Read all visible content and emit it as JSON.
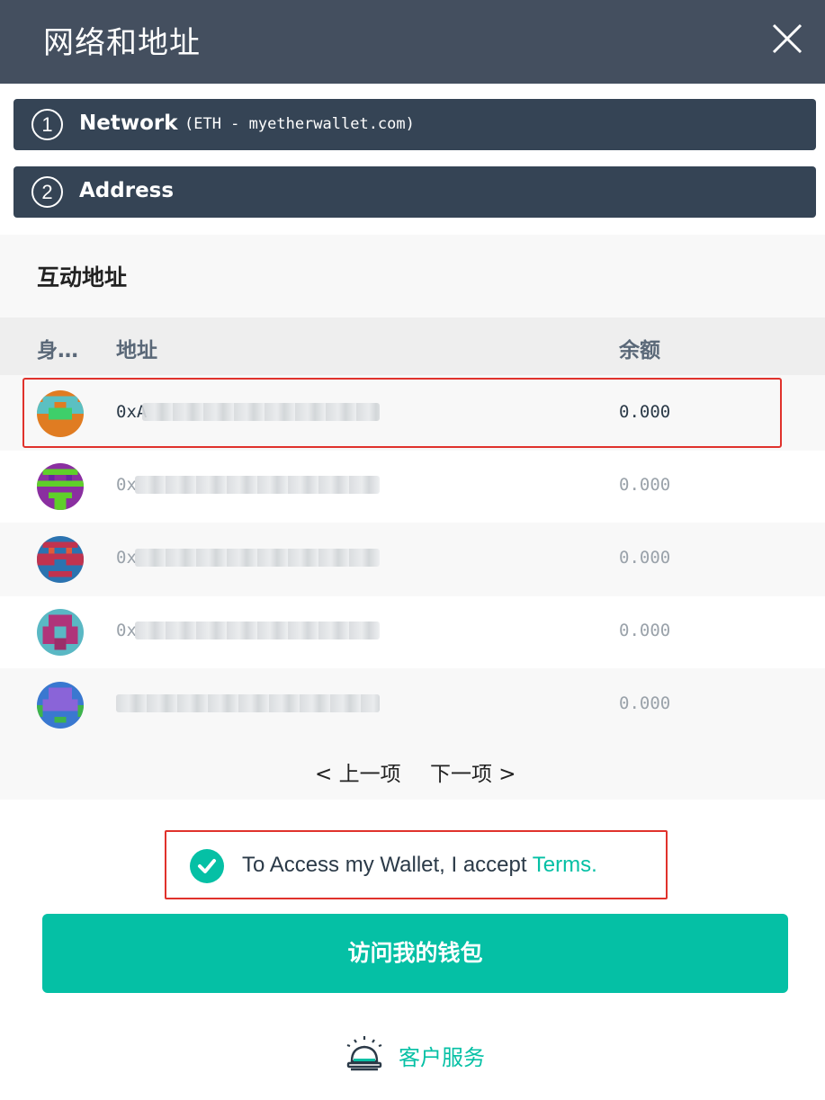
{
  "header": {
    "title": "网络和地址",
    "close_icon": "close-icon"
  },
  "steps": [
    {
      "number": "1",
      "label": "Network",
      "sub": "(ETH - myetherwallet.com)"
    },
    {
      "number": "2",
      "label": "Address"
    }
  ],
  "panel": {
    "title": "互动地址",
    "columns": {
      "id": "身…",
      "address": "地址",
      "balance": "余额"
    },
    "rows": [
      {
        "address_prefix": "0xA",
        "balance": "0.000",
        "avatar_colors": [
          "#e07c22",
          "#5bc0c2",
          "#3ecf6a"
        ]
      },
      {
        "address_prefix": "0x",
        "balance": "0.000",
        "avatar_colors": [
          "#8a2fa0",
          "#5fcf2a",
          "#6a24a0"
        ]
      },
      {
        "address_prefix": "0x",
        "balance": "0.000",
        "avatar_colors": [
          "#2b73b0",
          "#c0334f",
          "#e05b3a"
        ]
      },
      {
        "address_prefix": "0x",
        "balance": "0.000",
        "avatar_colors": [
          "#5ab8c4",
          "#b0347a",
          "#9b2f6a"
        ]
      },
      {
        "address_prefix": "",
        "balance": "0.000",
        "avatar_colors": [
          "#3a78d0",
          "#8a64d8",
          "#3fb44a"
        ]
      }
    ],
    "pager": {
      "prev": "< 上一项",
      "next": "下一项 >"
    }
  },
  "terms": {
    "text": "To Access my Wallet, I accept ",
    "link": "Terms."
  },
  "access_button": {
    "label": "访问我的钱包"
  },
  "support": {
    "label": "客户服务",
    "icon": "service-bell-icon"
  },
  "colors": {
    "header_bg": "#444f5f",
    "step_bg": "#354455",
    "accent": "#05c0a5",
    "highlight": "#e0322c"
  }
}
